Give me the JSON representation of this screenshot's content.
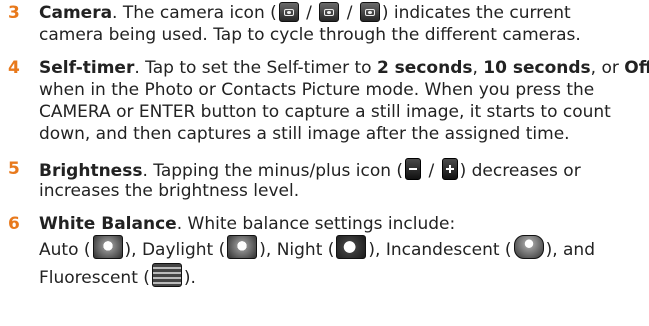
{
  "items": [
    {
      "number": "3",
      "title": "Camera",
      "lines": [
        [
          "Camera",
          ". The camera icon (",
          " / ",
          " / ",
          ") indicates the current"
        ],
        [
          "camera being used. Tap to cycle through the different cameras."
        ]
      ],
      "icons": [
        "camera-icon-1",
        "camera-icon-2",
        "camera-icon-3"
      ]
    },
    {
      "number": "4",
      "title": "Self-timer",
      "line1_after": ". Tap to set the Self-timer to ",
      "opt1": "2 seconds",
      "sep1": ", ",
      "opt2": "10 seconds",
      "sep2": ", or ",
      "opt3": "Off",
      "line2": "when in the Photo or Contacts Picture mode. When you press the",
      "line3": "CAMERA or ENTER button to capture a still image, it starts to count",
      "line4": "down, and then captures a still image after the assigned time."
    },
    {
      "number": "5",
      "title": "Brightness",
      "line1_after": ". Tapping the minus/plus icon (",
      "slash": " / ",
      "line1_end": ") decreases or",
      "line2": "increases the brightness level.",
      "icons": [
        "minus-icon",
        "plus-icon"
      ]
    },
    {
      "number": "6",
      "title": "White Balance",
      "line1_after": ". White balance settings include:",
      "auto": "Auto (",
      "daylight": "), Daylight (",
      "night": "), Night (",
      "incandescent": "), Incandescent (",
      "and": "), and",
      "fluorescent": "Fluorescent (",
      "end": ")."
    }
  ]
}
